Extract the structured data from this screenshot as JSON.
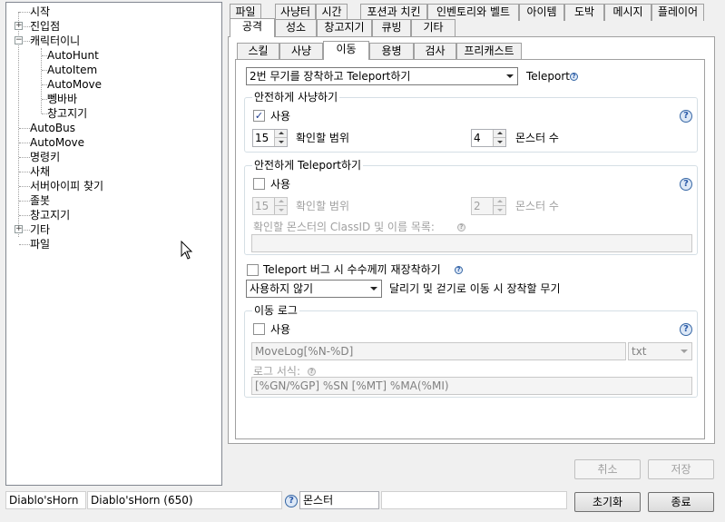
{
  "tree": {
    "items": [
      {
        "label": "시작"
      },
      {
        "label": "진입점",
        "expander": "+"
      },
      {
        "label": "캐릭터이니",
        "expander": "−"
      },
      {
        "label": "AutoHunt"
      },
      {
        "label": "AutoItem"
      },
      {
        "label": "AutoMove"
      },
      {
        "label": "뼁바바"
      },
      {
        "label": "창고지기"
      },
      {
        "label": "AutoBus"
      },
      {
        "label": "AutoMove"
      },
      {
        "label": "명령키"
      },
      {
        "label": "사채"
      },
      {
        "label": "서버아이피 찾기"
      },
      {
        "label": "졸봇"
      },
      {
        "label": "창고지기"
      },
      {
        "label": "기타",
        "expander": "+"
      },
      {
        "label": "파일"
      }
    ]
  },
  "tabs_row1": [
    "파일",
    "사냥터",
    "시간",
    "포션과 치킨",
    "인벤토리와 벨트",
    "아이템",
    "도박",
    "메시지",
    "플레이어"
  ],
  "tabs_row2": [
    "공격",
    "성소",
    "창고지기",
    "큐빙",
    "기타"
  ],
  "subtabs": [
    "스킬",
    "사냥",
    "이동",
    "용병",
    "검사",
    "프리캐스트"
  ],
  "move": {
    "weapon_combo": "2번 무기를 장착하고 Teleport하기",
    "weapon_label": "Teleport",
    "safe_hunt": {
      "title": "안전하게 사냥하기",
      "use_label": "사용",
      "range_value": "15",
      "range_label": "확인할 범위",
      "monster_value": "4",
      "monster_label": "몬스터 수"
    },
    "safe_tele": {
      "title": "안전하게 Teleport하기",
      "use_label": "사용",
      "range_value": "15",
      "range_label": "확인할 범위",
      "monster_value": "2",
      "monster_label": "몬스터 수",
      "list_label": "확인할 몬스터의 ClassID 및 이름 목록:",
      "list_value": ""
    },
    "bug_label": "Teleport 버그 시 수수께끼 재장착하기",
    "walk_combo": "사용하지 않기",
    "walk_label": "달리기 및 걷기로 이동 시 장착할 무기",
    "log": {
      "title": "이동 로그",
      "use_label": "사용",
      "file_value": "MoveLog[%N-%D]",
      "ext_value": "txt",
      "format_label": "로그 서식:",
      "format_value": "[%GN/%GP] %SN [%MT] %MA(%MI)"
    }
  },
  "buttons": {
    "cancel": "취소",
    "save": "저장",
    "reset": "초기화",
    "exit": "종료"
  },
  "status": {
    "profile": "Diablo'sHorn",
    "profile_full": "Diablo'sHorn (650)",
    "search_value": "몬스터"
  },
  "colors": {
    "window_bg": "#f0f0f0",
    "help_blue": "#2a5aa8",
    "check_blue": "#1c3a8c"
  },
  "state": {
    "selected_tab_row2": "공격",
    "selected_subtab": "이동",
    "safe_hunt_checked": true,
    "safe_tele_checked": false,
    "bug_checked": false,
    "log_checked": false
  },
  "glyphs": {
    "help": "?",
    "check": "✓"
  }
}
